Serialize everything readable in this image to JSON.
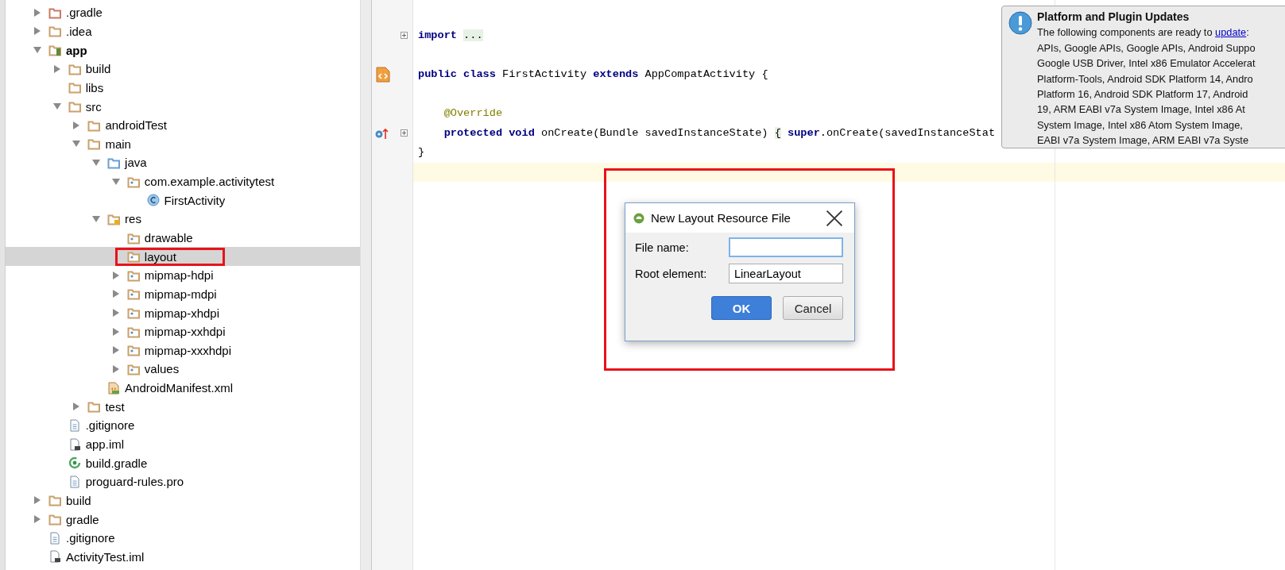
{
  "project_tree": {
    "items": [
      {
        "label": ".gradle",
        "kind": "folder-excluded",
        "expanded": false
      },
      {
        "label": ".idea",
        "kind": "folder",
        "expanded": false
      },
      {
        "label": "app",
        "kind": "module",
        "expanded": true,
        "children": [
          {
            "label": "build",
            "kind": "folder",
            "expanded": false
          },
          {
            "label": "libs",
            "kind": "folder"
          },
          {
            "label": "src",
            "kind": "folder",
            "expanded": true,
            "children": [
              {
                "label": "androidTest",
                "kind": "folder",
                "expanded": false
              },
              {
                "label": "main",
                "kind": "folder",
                "expanded": true,
                "children": [
                  {
                    "label": "java",
                    "kind": "source-folder",
                    "expanded": true,
                    "children": [
                      {
                        "label": "com.example.activitytest",
                        "kind": "package",
                        "expanded": true,
                        "children": [
                          {
                            "label": "FirstActivity",
                            "kind": "class"
                          }
                        ]
                      }
                    ]
                  },
                  {
                    "label": "res",
                    "kind": "res-folder",
                    "expanded": true,
                    "children": [
                      {
                        "label": "drawable",
                        "kind": "package"
                      },
                      {
                        "label": "layout",
                        "kind": "package",
                        "selected": true,
                        "annotated": true
                      },
                      {
                        "label": "mipmap-hdpi",
                        "kind": "package",
                        "expanded": false
                      },
                      {
                        "label": "mipmap-mdpi",
                        "kind": "package",
                        "expanded": false
                      },
                      {
                        "label": "mipmap-xhdpi",
                        "kind": "package",
                        "expanded": false
                      },
                      {
                        "label": "mipmap-xxhdpi",
                        "kind": "package",
                        "expanded": false
                      },
                      {
                        "label": "mipmap-xxxhdpi",
                        "kind": "package",
                        "expanded": false
                      },
                      {
                        "label": "values",
                        "kind": "package",
                        "expanded": false
                      }
                    ]
                  },
                  {
                    "label": "AndroidManifest.xml",
                    "kind": "manifest"
                  }
                ]
              },
              {
                "label": "test",
                "kind": "folder",
                "expanded": false
              }
            ]
          },
          {
            "label": ".gitignore",
            "kind": "file"
          },
          {
            "label": "app.iml",
            "kind": "iml"
          },
          {
            "label": "build.gradle",
            "kind": "gradle"
          },
          {
            "label": "proguard-rules.pro",
            "kind": "file"
          }
        ]
      },
      {
        "label": "build",
        "kind": "folder",
        "expanded": false
      },
      {
        "label": "gradle",
        "kind": "folder",
        "expanded": false
      },
      {
        "label": ".gitignore",
        "kind": "file"
      },
      {
        "label": "ActivityTest.iml",
        "kind": "iml"
      }
    ]
  },
  "editor": {
    "lines": [
      {
        "current": false
      },
      {
        "foldable": true,
        "current": false,
        "tokens": [
          {
            "kind": "keyword",
            "text": "import"
          },
          {
            "kind": "fold",
            "text": "...",
            "sep": true
          }
        ]
      },
      {
        "current": false
      },
      {
        "layout_marker": true,
        "current": false,
        "tokens": [
          {
            "kind": "keyword",
            "text": "public class"
          },
          {
            "kind": "plain",
            "text": "FirstActivity",
            "sep": true
          },
          {
            "kind": "keyword",
            "text": "extends",
            "sep": true
          },
          {
            "kind": "plain",
            "text": "AppCompatActivity {",
            "sep": true
          }
        ]
      },
      {
        "current": false
      },
      {
        "indent": true,
        "current": false,
        "tokens": [
          {
            "kind": "annotation",
            "text": "@Override"
          }
        ]
      },
      {
        "override_marker": true,
        "foldable": true,
        "indent": true,
        "current": false,
        "tokens": [
          {
            "kind": "keyword",
            "text": "protected void"
          },
          {
            "kind": "plain",
            "text": "onCreate(Bundle savedInstanceState)",
            "sep": true
          },
          {
            "kind": "fold",
            "text": "{",
            "sep": true
          },
          {
            "kind": "keyword",
            "text": "super",
            "sep": true
          },
          {
            "kind": "plain",
            "text": ".onCreate(savedInstanceStat"
          }
        ]
      },
      {
        "current": false,
        "tokens": [
          {
            "kind": "plain",
            "text": "}"
          }
        ]
      },
      {
        "current": true
      }
    ]
  },
  "notification": {
    "title": "Platform and Plugin Updates",
    "intro": "The following components are ready to ",
    "link": "update",
    "after_link": ":",
    "lines": [
      "APIs, Google APIs, Google APIs, Android Suppo",
      "Google USB Driver, Intel x86 Emulator Accelerat",
      "Platform-Tools, Android SDK Platform 14, Andro",
      "Platform 16, Android SDK Platform 17, Android",
      "19, ARM EABI v7a System Image, Intel x86 At",
      "System Image, Intel x86 Atom System Image,",
      "EABI v7a System Image, ARM EABI v7a Syste"
    ]
  },
  "dialog": {
    "title": "New Layout Resource File",
    "fields": [
      {
        "label": "File name:",
        "focused": true
      },
      {
        "label": "Root element:",
        "value": "LinearLayout",
        "focused": false
      }
    ],
    "buttons": [
      {
        "label": "OK",
        "default": true
      },
      {
        "label": "Cancel",
        "default": false
      }
    ]
  }
}
